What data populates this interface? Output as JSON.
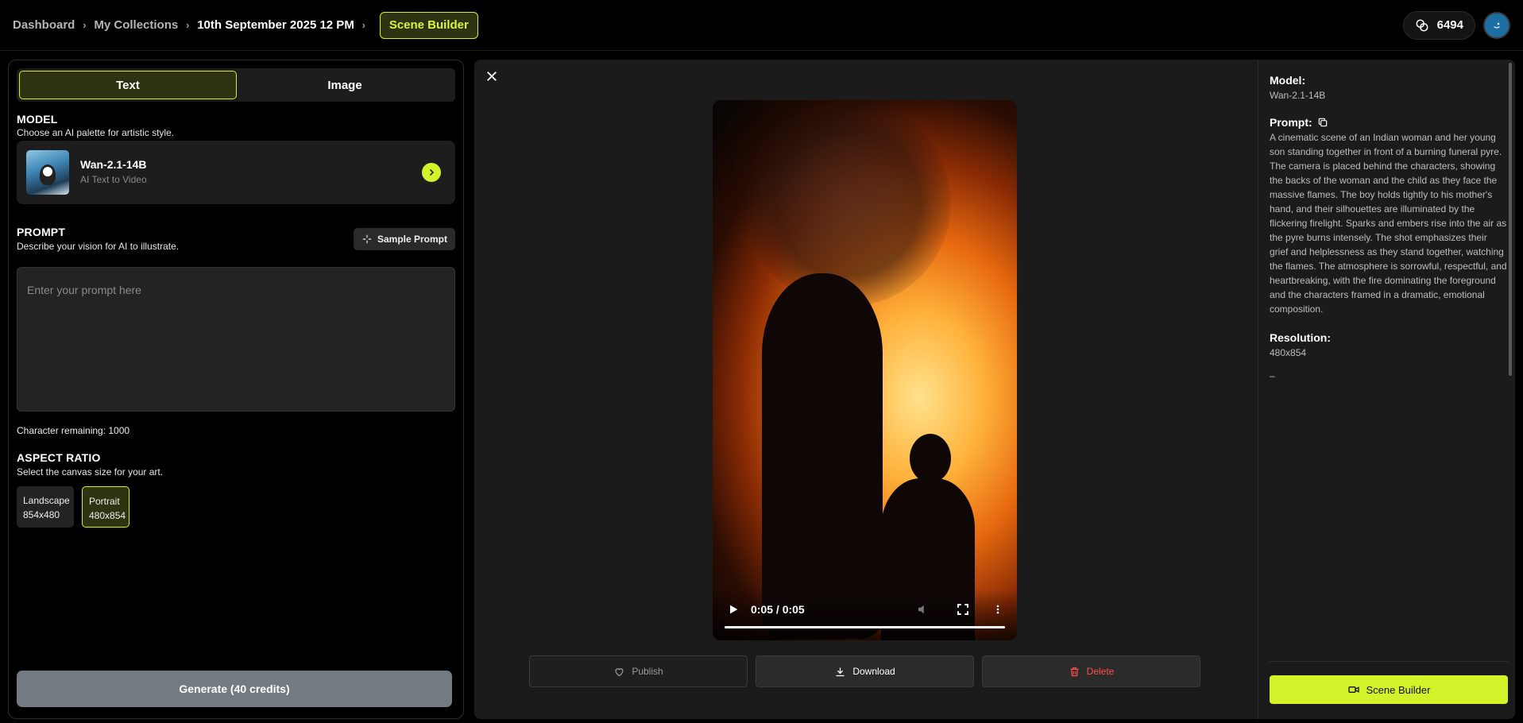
{
  "breadcrumb": {
    "items": [
      "Dashboard",
      "My Collections",
      "10th September 2025 12 PM"
    ],
    "action": "Scene Builder"
  },
  "header": {
    "credits": "6494"
  },
  "left_panel": {
    "tabs": [
      "Text",
      "Image"
    ],
    "active_tab": "Text",
    "model": {
      "title": "MODEL",
      "subtitle": "Choose an AI palette for artistic style.",
      "name": "Wan-2.1-14B",
      "type": "AI Text to Video"
    },
    "prompt": {
      "title": "PROMPT",
      "subtitle": "Describe your vision for AI to illustrate.",
      "sample_button": "Sample Prompt",
      "placeholder": "Enter your prompt here",
      "value": ""
    },
    "char_remaining": "Character remaining: 1000",
    "aspect_ratio": {
      "title": "ASPECT RATIO",
      "subtitle": "Select the canvas size for your art.",
      "options": [
        {
          "label": "Landscape",
          "size": "854x480"
        },
        {
          "label": "Portrait",
          "size": "480x854"
        }
      ],
      "selected": "Portrait"
    },
    "generate_button": "Generate (40 credits)"
  },
  "preview": {
    "video_time": "0:05 / 0:05",
    "progress": 1.0,
    "actions": {
      "publish": "Publish",
      "download": "Download",
      "delete": "Delete"
    }
  },
  "details": {
    "model_label": "Model:",
    "model_value": "Wan-2.1-14B",
    "prompt_label": "Prompt:",
    "prompt_value": "A cinematic scene of an Indian woman and her young son standing together in front of a burning funeral pyre. The camera is placed behind the characters, showing the backs of the woman and the child as they face the massive flames. The boy holds tightly to his mother's hand, and their silhouettes are illuminated by the flickering firelight. Sparks and embers rise into the air as the pyre burns intensely. The shot emphasizes their grief and helplessness as they stand together, watching the flames. The atmosphere is sorrowful, respectful, and heartbreaking, with the fire dominating the foreground and the characters framed in a dramatic, emotional composition.",
    "resolution_label": "Resolution:",
    "resolution_value": "480x854",
    "extra": "–",
    "scene_builder_button": "Scene Builder"
  },
  "colors": {
    "accent": "#d4f22a",
    "danger": "#ff4d4d",
    "panel": "#1b1b1b"
  }
}
